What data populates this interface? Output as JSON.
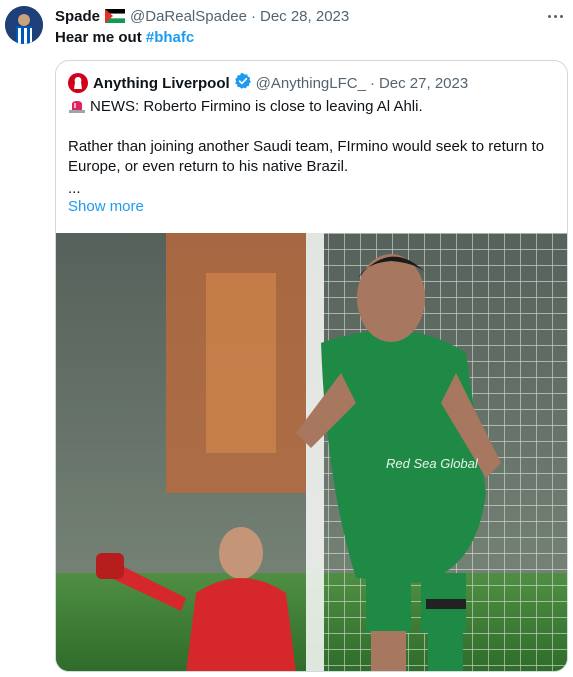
{
  "tweet": {
    "author_name": "Spade",
    "author_handle": "@DaRealSpadee",
    "separator": "·",
    "date": "Dec 28, 2023",
    "text_prefix": "Hear me out ",
    "hashtag": "#bhafc"
  },
  "quote": {
    "author_name": "Anything Liverpool",
    "author_handle": "@AnythingLFC_",
    "separator": "·",
    "date": "Dec 27, 2023",
    "line1": "NEWS: Roberto Firmino is close to leaving Al Ahli.",
    "line2": "Rather than joining another Saudi team, FIrmino would seek to return to Europe, or even return to his native Brazil.",
    "line3": "...",
    "show_more": "Show more",
    "shirt_sponsor": "Red Sea Global"
  },
  "colors": {
    "link": "#1d9bf0",
    "muted": "#536471",
    "border": "#cfd9de",
    "verified": "#1d9bf0"
  },
  "icons": [
    "more-icon",
    "palestine-flag-icon",
    "verified-badge-icon",
    "siren-emoji-icon"
  ]
}
